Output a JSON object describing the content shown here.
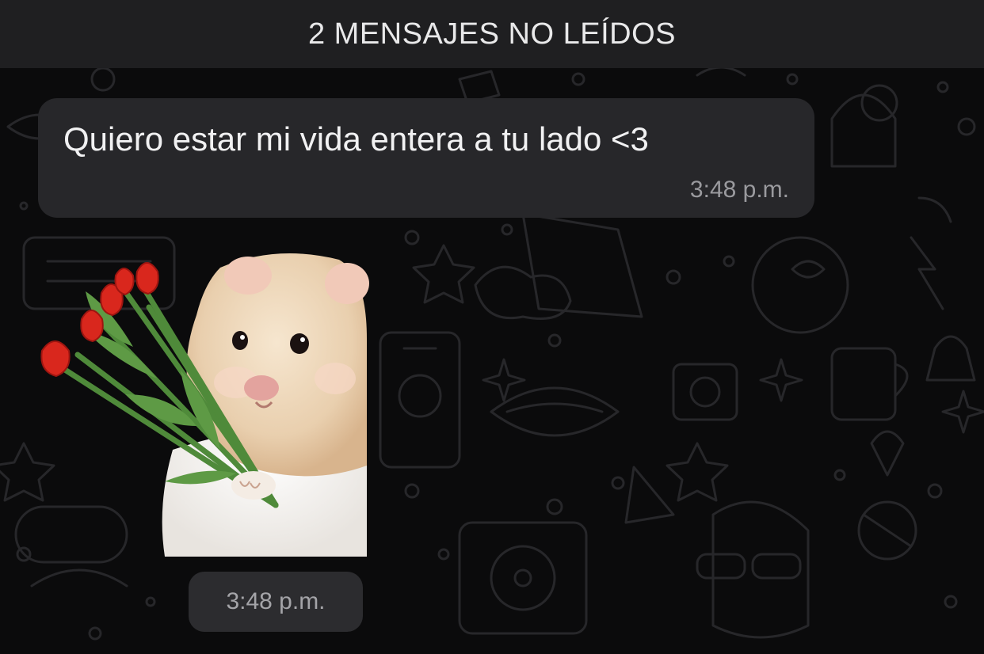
{
  "banner": {
    "text": "2 MENSAJES NO LEÍDOS"
  },
  "messages": [
    {
      "type": "text",
      "text": "Quiero estar mi vida entera a tu lado <3",
      "time": "3:48 p.m."
    },
    {
      "type": "sticker",
      "sticker": "hamster-holding-red-tulips",
      "time": "3:48 p.m."
    }
  ],
  "colors": {
    "background": "#0b0b0c",
    "banner": "#1f1f21",
    "bubble": "#27272a",
    "text": "#f1f1f2",
    "timestamp": "#9a9a9e"
  }
}
